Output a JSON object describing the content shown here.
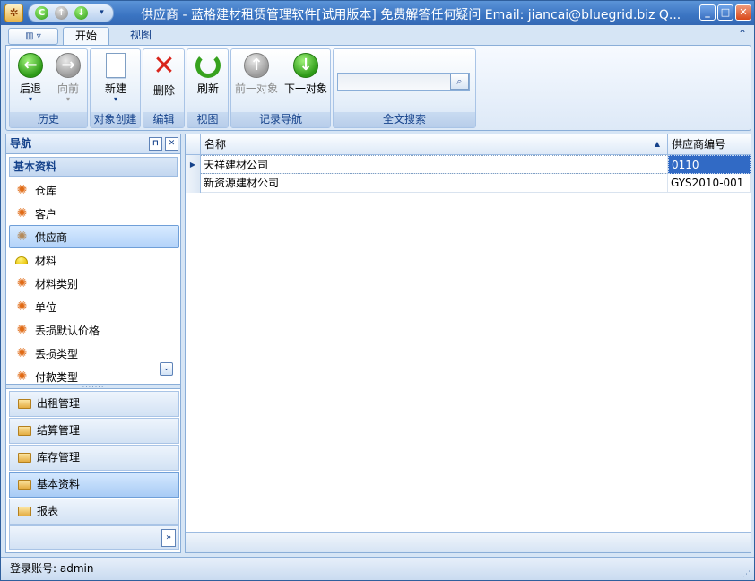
{
  "window": {
    "title": "供应商 - 蓝格建材租赁管理软件[试用版本] 免费解答任何疑问 Email: jiancai@bluegrid.biz Q..."
  },
  "tabs": [
    {
      "label": "开始",
      "active": true
    },
    {
      "label": "视图",
      "active": false
    }
  ],
  "ribbon": {
    "groups": {
      "history": "历史",
      "create": "对象创建",
      "edit": "编辑",
      "view": "视图",
      "record_nav": "记录导航",
      "fulltext": "全文搜索"
    },
    "buttons": {
      "back": "后退",
      "forward": "向前",
      "new": "新建",
      "delete": "删除",
      "refresh": "刷新",
      "prev_object": "前一对象",
      "next_object": "下一对象"
    },
    "search": {
      "value": "",
      "placeholder": ""
    }
  },
  "nav": {
    "title": "导航",
    "section": "基本资料",
    "items": [
      {
        "label": "仓库",
        "icon": "gear-icon"
      },
      {
        "label": "客户",
        "icon": "gear-icon"
      },
      {
        "label": "供应商",
        "icon": "gear-icon",
        "selected": true
      },
      {
        "label": "材料",
        "icon": "helmet-icon"
      },
      {
        "label": "材料类别",
        "icon": "gear-icon"
      },
      {
        "label": "单位",
        "icon": "gear-icon"
      },
      {
        "label": "丢损默认价格",
        "icon": "gear-icon"
      },
      {
        "label": "丢损类型",
        "icon": "gear-icon"
      },
      {
        "label": "付款类型",
        "icon": "gear-icon"
      }
    ],
    "groups": [
      {
        "label": "出租管理"
      },
      {
        "label": "结算管理"
      },
      {
        "label": "库存管理"
      },
      {
        "label": "基本资料",
        "active": true
      },
      {
        "label": "报表"
      }
    ]
  },
  "grid": {
    "columns": [
      "名称",
      "供应商编号"
    ],
    "rows": [
      {
        "name": "天祥建材公司",
        "code": "0110"
      },
      {
        "name": "新资源建材公司",
        "code": "GYS2010-001"
      }
    ]
  },
  "status": {
    "login": "登录账号: admin"
  },
  "colors": {
    "accent": "#316ac5",
    "titlebar": "#3a74c2",
    "frame": "#d6e5f5"
  }
}
